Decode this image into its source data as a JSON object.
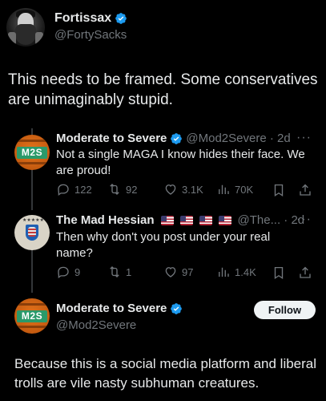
{
  "author": {
    "name": "Fortissax",
    "handle": "@FortySacks"
  },
  "post": {
    "text": "This needs to be framed. Some conservatives are unimaginably stupid."
  },
  "quoted": [
    {
      "name": "Moderate to Severe",
      "handle_time": "@Mod2Severe · 2d",
      "avatar_text": "M2S",
      "text": "Not a single MAGA I know hides their face. We are proud!",
      "stats": {
        "replies": "122",
        "reposts": "92",
        "likes": "3.1K",
        "views": "70K"
      }
    },
    {
      "name": "The Mad Hessian",
      "handle_time": "@The... · 2d",
      "text": "Then why don't you post under your real name?",
      "stats": {
        "replies": "9",
        "reposts": "1",
        "likes": "97",
        "views": "1.4K"
      }
    }
  ],
  "reply": {
    "name": "Moderate to Severe",
    "handle": "@Mod2Severe",
    "avatar_text": "M2S",
    "follow_label": "Follow",
    "text": "Because this is a social media platform and liberal trolls are vile nasty subhuman creatures."
  },
  "more_label": "···",
  "colors": {
    "background": "#000000",
    "text": "#e7e9ea",
    "muted": "#71767b",
    "verified": "#1d9bf0",
    "m2s_orange": "#d7651a",
    "m2s_green": "#2a9a6a"
  }
}
